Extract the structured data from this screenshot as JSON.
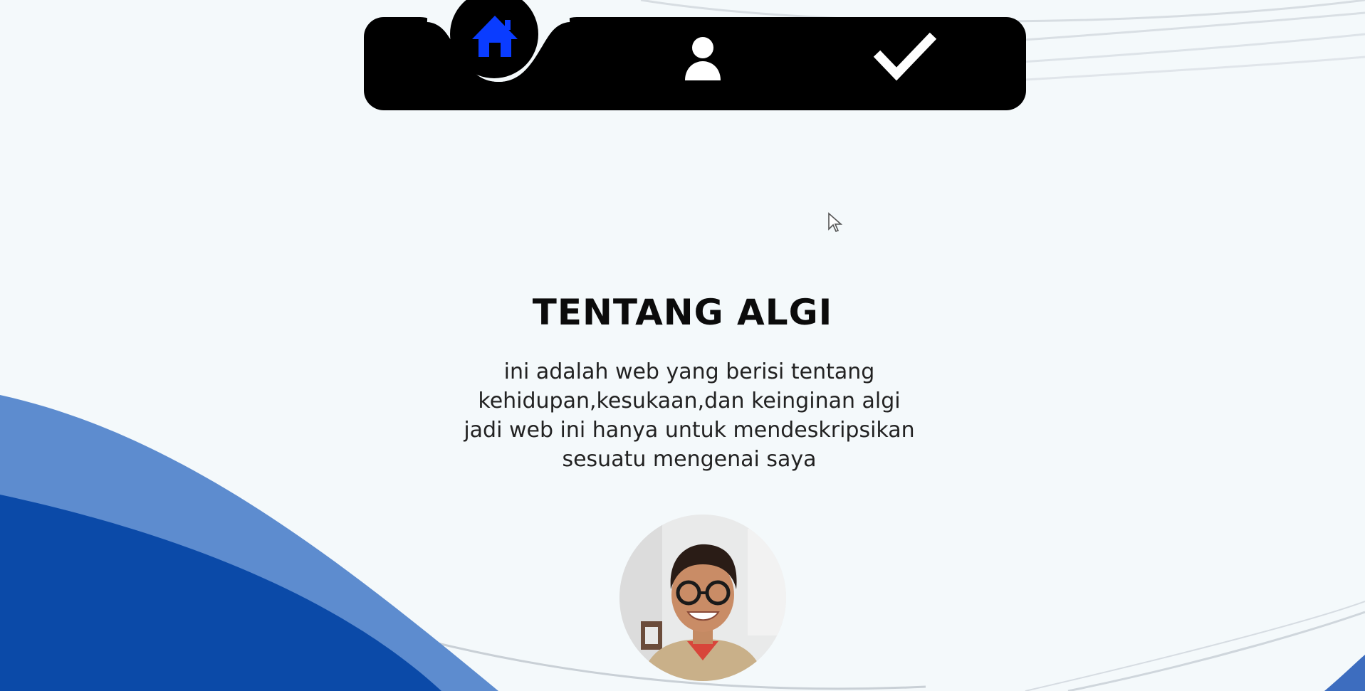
{
  "nav": {
    "items": [
      {
        "name": "home",
        "icon": "home-icon",
        "active": true
      },
      {
        "name": "profile",
        "icon": "user-icon",
        "active": false
      },
      {
        "name": "check",
        "icon": "check-icon",
        "active": false
      }
    ],
    "active_icon_color": "#0a3cff",
    "inactive_icon_color": "#ffffff",
    "bar_color": "#000000"
  },
  "about": {
    "title": "TENTANG ALGI",
    "lines": [
      "ini adalah web yang berisi tentang",
      "kehidupan,kesukaan,dan keinginan algi",
      "jadi web ini hanya untuk mendeskripsikan",
      "sesuatu mengenai saya"
    ]
  },
  "colors": {
    "background": "#f4f9fb",
    "wave_light": "#5d8ccf",
    "wave_dark": "#0b4aa8"
  }
}
